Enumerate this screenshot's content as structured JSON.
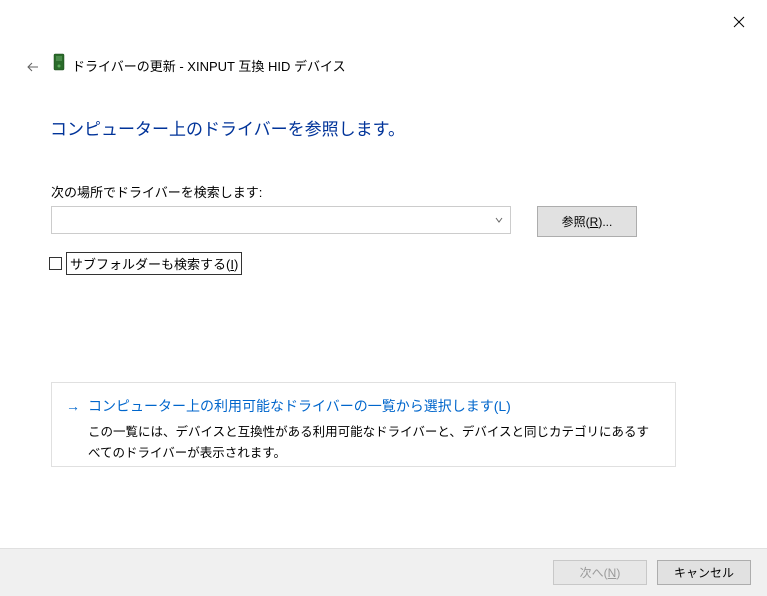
{
  "header": {
    "title": "ドライバーの更新 - XINPUT 互換 HID デバイス"
  },
  "heading": "コンピューター上のドライバーを参照します。",
  "search": {
    "label": "次の場所でドライバーを検索します:",
    "path_value": "",
    "browse_label": "参照(R)..."
  },
  "subfolder": {
    "label": "サブフォルダーも検索する(I)"
  },
  "pick_option": {
    "title": "コンピューター上の利用可能なドライバーの一覧から選択します(L)",
    "desc": "この一覧には、デバイスと互換性がある利用可能なドライバーと、デバイスと同じカテゴリにあるすべてのドライバーが表示されます。"
  },
  "buttons": {
    "next": "次へ(N)",
    "cancel": "キャンセル"
  }
}
